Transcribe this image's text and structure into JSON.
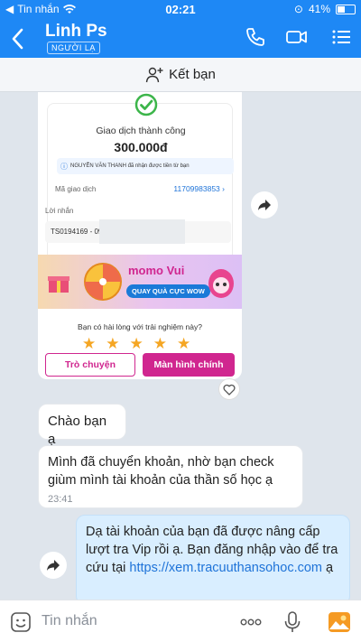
{
  "status_bar": {
    "carrier": "Tin nhắn",
    "time": "02:21",
    "battery": "41%"
  },
  "header": {
    "back_icon": "chevron-left-icon",
    "contact_name": "Linh Ps",
    "badge": "NGƯỜI LẠ"
  },
  "friend_bar": {
    "label": "Kết bạn"
  },
  "transaction_card": {
    "title": "Giao dịch thành công",
    "amount": "300.000đ",
    "note": "NGUYỄN VĂN THANH đã nhận được tiền từ bạn",
    "code_label": "Mã giao dịch",
    "code_value": "11709983853",
    "message_label": "Lời nhắn",
    "message_value": "TS0194169 - 09",
    "banner_title": "momo Vui",
    "banner_cta": "QUAY QUÀ CỰC WOW",
    "rating_question": "Bạn có hài lòng với trải nghiệm này?",
    "stars": 5,
    "chat_button": "Trò chuyện",
    "home_button": "Màn hình chính"
  },
  "messages": [
    {
      "text": "Chào bạn ạ",
      "time": ""
    },
    {
      "text": "Mình đã chuyển khoản, nhờ bạn check giùm mình tài khoản của thần số học ạ",
      "time": "23:41"
    },
    {
      "text_before_link": "Dạ tài khoản của bạn đã được nâng cấp lượt tra Vip rồi ạ. Bạn đăng nhập vào để tra cứu tại ",
      "link": "https://xem.tracuuthansohoc.com",
      "text_after_link": " ạ"
    }
  ],
  "input_bar": {
    "placeholder": "Tin nhắn"
  },
  "colors": {
    "primary": "#1e88f5",
    "momo": "#d0268f",
    "link": "#1e73d8"
  }
}
